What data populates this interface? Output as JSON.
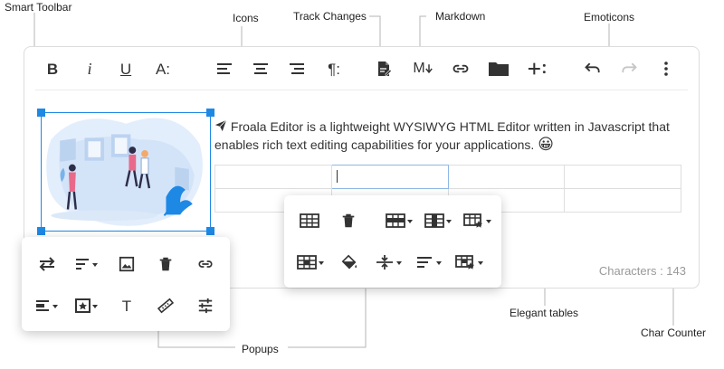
{
  "callouts": {
    "smart_toolbar": "Smart Toolbar",
    "icons": "Icons",
    "track_changes": "Track Changes",
    "markdown": "Markdown",
    "emoticons": "Emoticons",
    "elegant_tables": "Elegant tables",
    "char_counter": "Char Counter",
    "popups": "Popups"
  },
  "toolbar": {
    "bold_label": "B",
    "italic_label": "i",
    "underline_label": "U",
    "font_size_label": "A:",
    "paragraph_label": "¶:",
    "markdown_label": "M"
  },
  "content": {
    "paragraph": "Froala Editor is a lightweight WYSIWYG HTML Editor written in Javascript that enables rich text editing capabilities for your applications.",
    "emoji": "😀"
  },
  "status": {
    "char_counter": "Characters : 143"
  },
  "image_popup": {
    "text_button_label": "T"
  },
  "colors": {
    "accent": "#1e88e5",
    "image_blue": "#c9def7",
    "figure_dark": "#2d2d4a",
    "figure_pink": "#e86a8a"
  }
}
